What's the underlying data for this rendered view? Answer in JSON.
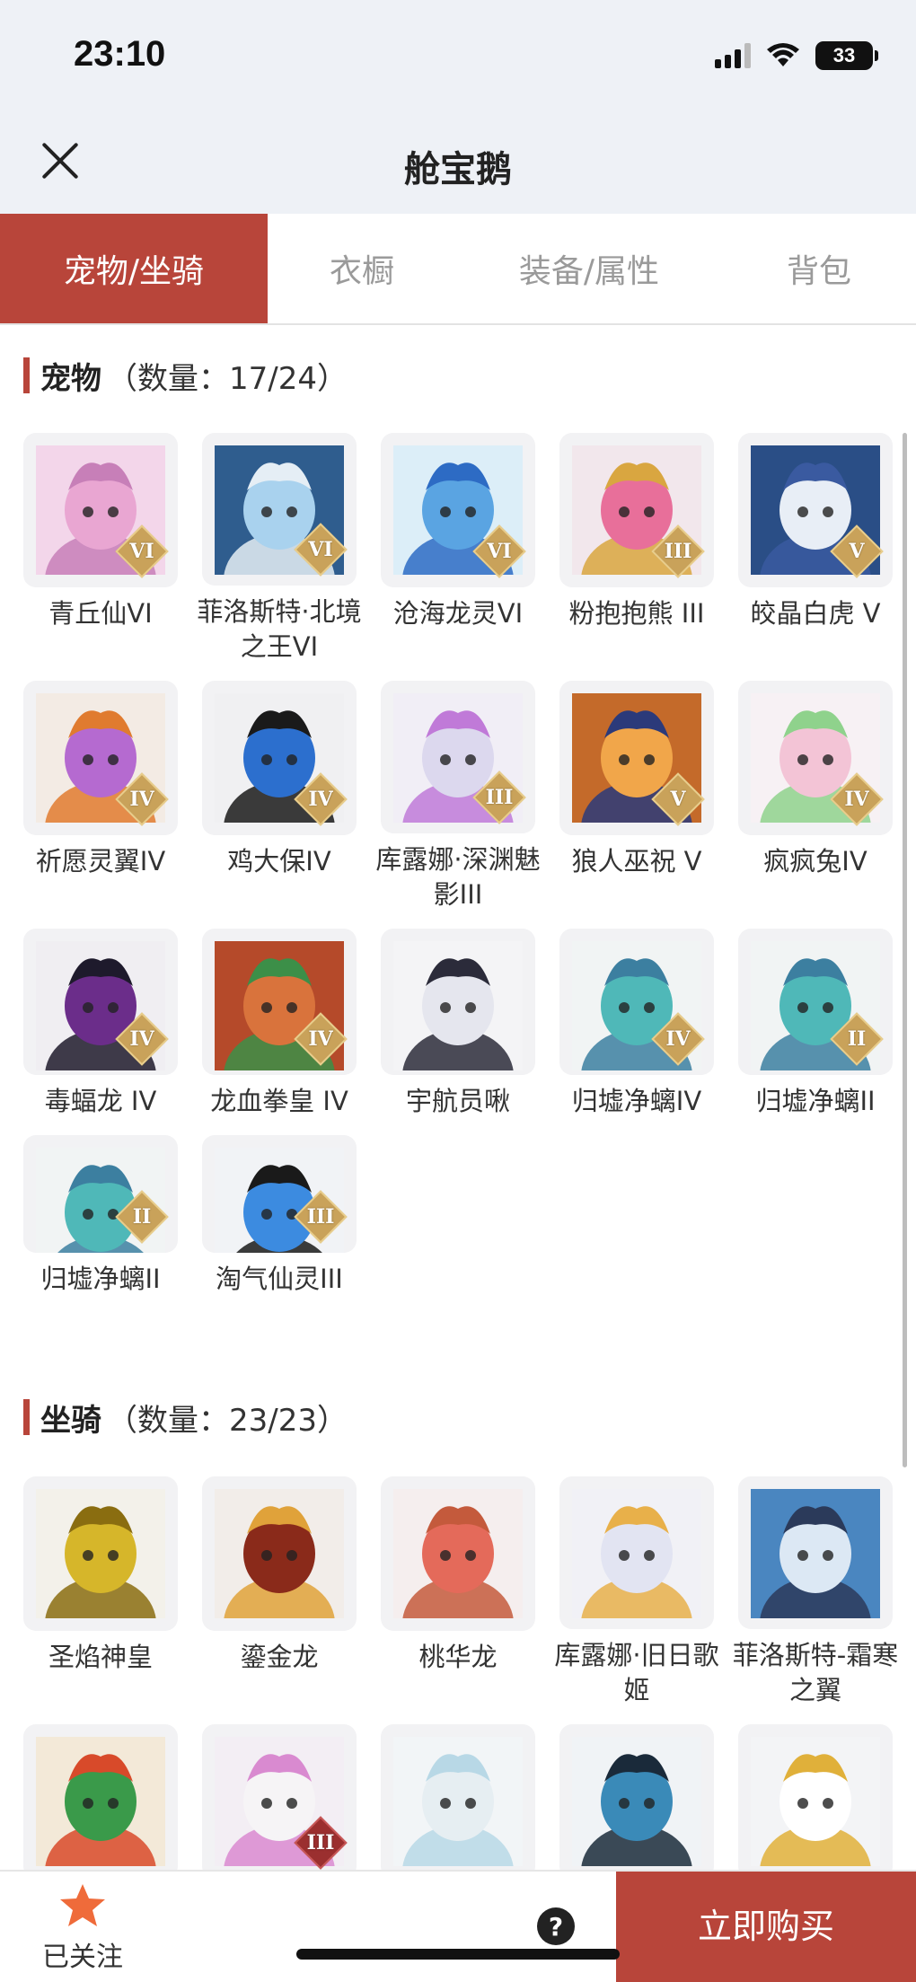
{
  "status": {
    "time": "23:10",
    "battery": "33"
  },
  "header": {
    "title": "舱宝鹅"
  },
  "tabs": [
    {
      "label": "宠物/坐骑",
      "active": true
    },
    {
      "label": "衣橱",
      "active": false
    },
    {
      "label": "装备/属性",
      "active": false
    },
    {
      "label": "背包",
      "active": false
    }
  ],
  "pets": {
    "title": "宠物",
    "count": "（数量：17/24）",
    "items": [
      {
        "name": "青丘仙VI",
        "badge": "VI",
        "icon": "fox-fairy-portrait"
      },
      {
        "name": "菲洛斯特·北境之王VI",
        "badge": "VI",
        "icon": "frost-king-portrait"
      },
      {
        "name": "沧海龙灵VI",
        "badge": "VI",
        "icon": "sea-dragon-spirit-portrait"
      },
      {
        "name": "粉抱抱熊 III",
        "badge": "III",
        "icon": "pink-bear-portrait"
      },
      {
        "name": "皎晶白虎 V",
        "badge": "V",
        "icon": "white-tiger-portrait"
      },
      {
        "name": "祈愿灵翼IV",
        "badge": "IV",
        "icon": "phoenix-bird-portrait"
      },
      {
        "name": "鸡大保IV",
        "badge": "IV",
        "icon": "blue-bird-portrait"
      },
      {
        "name": "库露娜·深渊魅影III",
        "badge": "III",
        "icon": "kuluna-portrait"
      },
      {
        "name": "狼人巫祝 V",
        "badge": "V",
        "icon": "werewolf-portrait"
      },
      {
        "name": "疯疯兔IV",
        "badge": "IV",
        "icon": "bunny-portrait"
      },
      {
        "name": "毒蝠龙 IV",
        "badge": "IV",
        "icon": "purple-dragon-portrait"
      },
      {
        "name": "龙血拳皇 IV",
        "badge": "IV",
        "icon": "dragon-blood-portrait"
      },
      {
        "name": "宇航员啾",
        "badge": "",
        "icon": "astronaut-portrait"
      },
      {
        "name": "归墟净螭IV",
        "badge": "IV",
        "icon": "teal-dragon-portrait"
      },
      {
        "name": "归墟净螭II",
        "badge": "II",
        "icon": "teal-dragon-portrait"
      },
      {
        "name": "归墟净螭II",
        "badge": "II",
        "icon": "teal-dragon-portrait"
      },
      {
        "name": "淘气仙灵III",
        "badge": "III",
        "icon": "blue-puppy-portrait"
      }
    ]
  },
  "mounts": {
    "title": "坐骑",
    "count": "（数量：23/23）",
    "items": [
      {
        "name": "圣焰神皇",
        "badge": "",
        "icon": "golden-phoenix-portrait"
      },
      {
        "name": "鎏金龙",
        "badge": "",
        "icon": "gold-dragon-portrait"
      },
      {
        "name": "桃华龙",
        "badge": "",
        "icon": "peach-dragon-portrait"
      },
      {
        "name": "库露娜·旧日歌姬",
        "badge": "",
        "icon": "kuluna-singer-portrait"
      },
      {
        "name": "菲洛斯特-霜寒之翼",
        "badge": "",
        "icon": "frost-wing-portrait"
      },
      {
        "name": "",
        "badge": "",
        "icon": "feathered-lizard-portrait"
      },
      {
        "name": "",
        "badge": "III",
        "icon": "unicorn-portrait"
      },
      {
        "name": "",
        "badge": "",
        "icon": "white-deer-portrait"
      },
      {
        "name": "",
        "badge": "",
        "icon": "horned-beast-portrait"
      },
      {
        "name": "",
        "badge": "",
        "icon": "white-swan-portrait"
      }
    ]
  },
  "bottom": {
    "follow_label": "已关注",
    "help": "?",
    "buy_label": "立即购买"
  },
  "colors": {
    "accent": "#b8453a",
    "header_bg": "#eef1f6",
    "badge_gold": "#c9a25a"
  }
}
